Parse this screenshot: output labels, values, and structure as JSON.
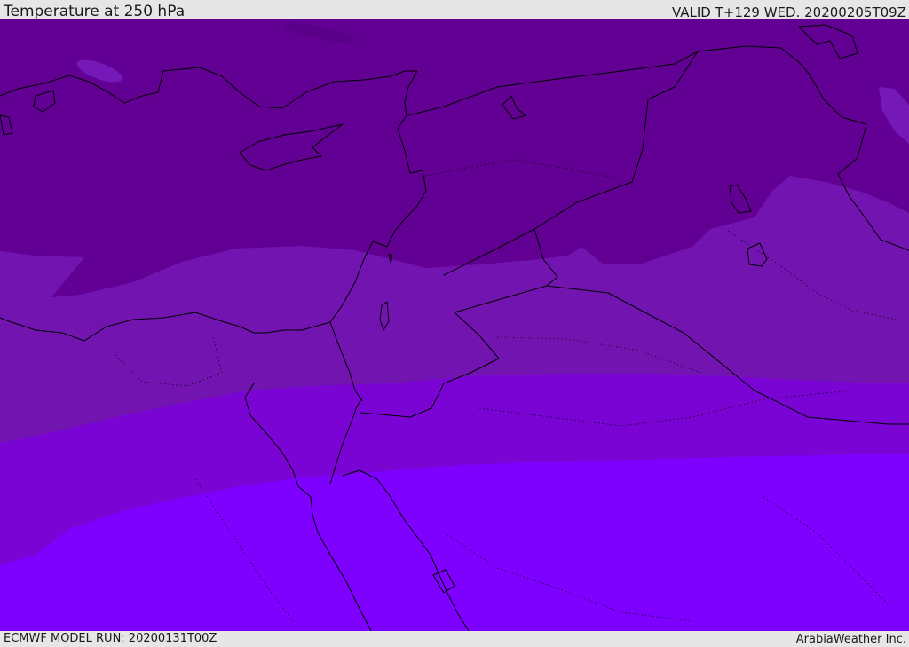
{
  "header": {
    "title": "Temperature at 250 hPa",
    "valid_time": "VALID T+129 WED. 20200205T09Z"
  },
  "footer": {
    "model_run": "ECMWF MODEL RUN: 20200131T00Z",
    "credit": "ArabiaWeather Inc."
  },
  "map": {
    "colors": {
      "band_coldest": "#630094",
      "band_cold": "#7214b0",
      "band_mid": "#7a04d4",
      "band_warm": "#7e00ff",
      "patch_light": "#7518b8",
      "coastline": "#000000"
    }
  }
}
